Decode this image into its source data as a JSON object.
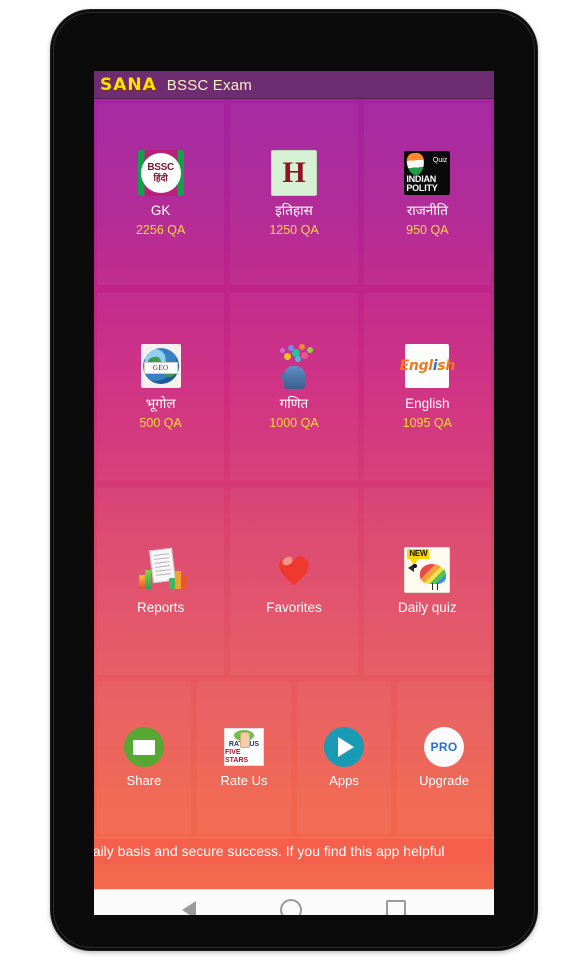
{
  "app": {
    "brand": "SANA",
    "title": "BSSC Exam"
  },
  "subjects": [
    {
      "icon": "bssc-hindi-icon",
      "label": "GK",
      "qa": "2256 QA",
      "icon_text": {
        "line1": "BSSC",
        "line2": "हिंदी"
      }
    },
    {
      "icon": "history-h-icon",
      "label": "इतिहास",
      "qa": "1250 QA",
      "icon_text": {
        "line1": "H"
      }
    },
    {
      "icon": "indian-polity-icon",
      "label": "राजनीति",
      "qa": "950 QA",
      "icon_text": {
        "line1": "Quiz",
        "line2": "INDIAN",
        "line3": "POLITY"
      }
    },
    {
      "icon": "geo-globe-icon",
      "label": "भूगोल",
      "qa": "500 QA",
      "icon_text": {
        "line1": "GEO"
      }
    },
    {
      "icon": "math-head-icon",
      "label": "गणित",
      "qa": "1000 QA",
      "icon_text": {}
    },
    {
      "icon": "english-icon",
      "label": "English",
      "qa": "1095 QA",
      "icon_text": {
        "line1": "Engl",
        "line2": "sh"
      }
    }
  ],
  "features": [
    {
      "icon": "reports-chart-icon",
      "label": "Reports"
    },
    {
      "icon": "heart-icon",
      "label": "Favorites"
    },
    {
      "icon": "new-bird-icon",
      "label": "Daily quiz",
      "badge": "NEW"
    }
  ],
  "actions": [
    {
      "icon": "envelope-icon",
      "label": "Share"
    },
    {
      "icon": "rate-us-icon",
      "label": "Rate Us",
      "icon_text": {
        "line1": "RATE US",
        "line2": "FIVE STARS"
      }
    },
    {
      "icon": "play-store-icon",
      "label": "Apps"
    },
    {
      "icon": "pro-badge-icon",
      "label": "Upgrade",
      "icon_text": {
        "line1": "PRO"
      }
    }
  ],
  "marquee": {
    "text": "daily basis and secure success. If you find this app helpful"
  },
  "navbar": {
    "back": "back-icon",
    "home": "home-icon",
    "recents": "recents-icon"
  },
  "colors": {
    "header": "#6e2d72",
    "brand_text": "#ffe100",
    "gradient_top": "#a3229f",
    "gradient_bottom": "#f4684d",
    "qa_text": "#ffd83a",
    "marquee_bg": "#f4604b"
  }
}
